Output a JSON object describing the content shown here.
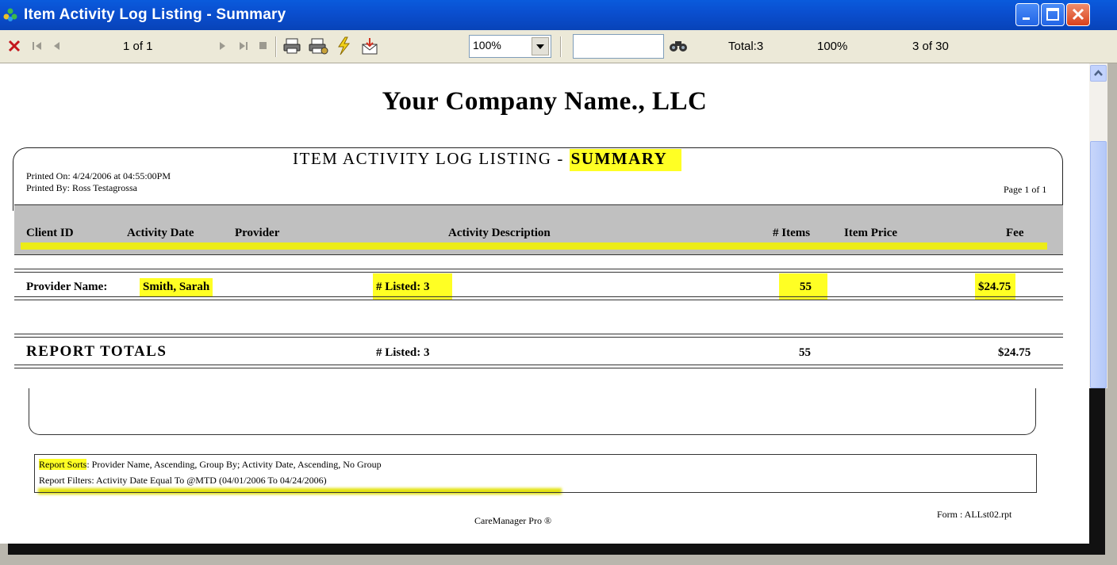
{
  "window": {
    "title": "Item Activity Log Listing - Summary"
  },
  "toolbar": {
    "page_indicator": "1 of 1",
    "zoom": "100%",
    "search_value": "",
    "total": "Total:3",
    "percent": "100%",
    "records": "3 of 30",
    "icons": [
      "close-icon",
      "first-page-icon",
      "prev-page-icon",
      "next-page-icon",
      "last-page-icon",
      "stop-icon",
      "print-icon",
      "print-setup-icon",
      "refresh-icon",
      "export-icon",
      "find-icon"
    ]
  },
  "report": {
    "company": "Your Company Name., LLC",
    "title_main": "ITEM ACTIVITY LOG LISTING - ",
    "title_highlight": "SUMMARY",
    "printed_on": "Printed On: 4/24/2006 at 04:55:00PM",
    "printed_by": "Printed By: Ross Testagrossa",
    "page": "Page 1 of 1",
    "columns": {
      "client_id": "Client ID",
      "activity_date": "Activity Date",
      "provider": "Provider",
      "activity_description": "Activity Description",
      "items": "# Items",
      "item_price": "Item Price",
      "fee": "Fee"
    },
    "group": {
      "label": "Provider Name: ",
      "name": "Smith, Sarah",
      "listed": "# Listed:  3",
      "items": "55",
      "fee": "$24.75"
    },
    "totals": {
      "label": "REPORT TOTALS",
      "listed": "# Listed:  3",
      "items": "55",
      "fee": "$24.75"
    },
    "sorts_label": "Report Sorts",
    "sorts_text": ": Provider Name, Ascending, Group By;  Activity Date, Ascending, No Group",
    "filters": "Report Filters: Activity Date Equal To @MTD (04/01/2006 To 04/24/2006)",
    "footer_center": "CareManager Pro ®",
    "footer_right": "Form : ALLst02.rpt"
  },
  "colors": {
    "highlight": "#ffff24",
    "titlebar": "#0a4fd0"
  }
}
